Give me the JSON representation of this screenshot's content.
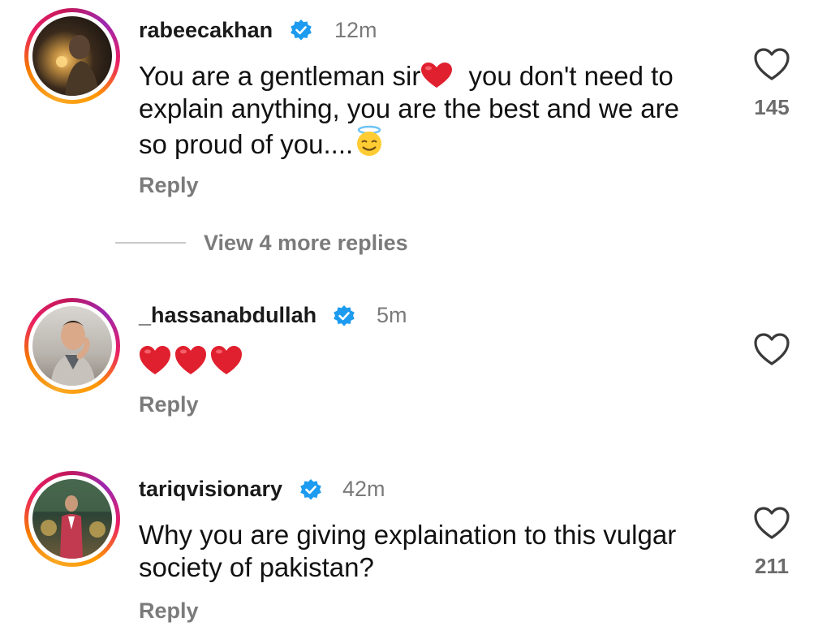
{
  "comments": [
    {
      "username": "rabeecakhan",
      "time": "12m",
      "text_parts": [
        "You are a gentleman sir",
        "you don't need to",
        "explain anything, you are the best and we are",
        "so proud of you...."
      ],
      "reply_label": "Reply",
      "likes": "145",
      "view_replies_label": "View 4 more replies"
    },
    {
      "username": "_hassanabdullah",
      "time": "5m",
      "reply_label": "Reply",
      "likes": ""
    },
    {
      "username": "tariqvisionary",
      "time": "42m",
      "text_lines": [
        "Why you are giving explaination to this vulgar",
        "society of pakistan?"
      ],
      "reply_label": "Reply",
      "likes": "211"
    }
  ],
  "icons": {
    "verified": "verified-badge-icon",
    "like": "heart-outline-icon",
    "emoji_heart": "red-heart-emoji",
    "emoji_halo": "smiling-face-with-halo-emoji"
  },
  "colors": {
    "verified_blue": "#1d9bf0",
    "heart_red": "#e0202e",
    "secondary_text": "#7b7b7b"
  }
}
